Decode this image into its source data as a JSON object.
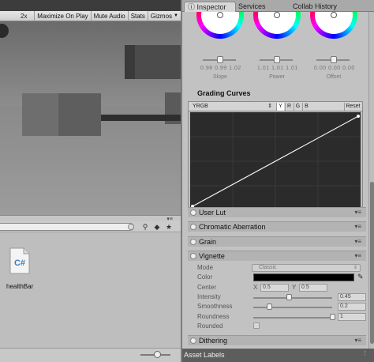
{
  "game_toolbar": {
    "zoom": "2x",
    "maximize_on_play": "Maximize On Play",
    "mute_audio": "Mute Audio",
    "stats": "Stats",
    "gizmos": "Gizmos"
  },
  "project": {
    "asset_name": "healthBar",
    "asset_glyph": "C#"
  },
  "inspector": {
    "tabs": [
      "Inspector",
      "Services",
      "Collab History"
    ],
    "wheels": [
      {
        "label": "Slope",
        "values": "0.98  0.99  1.02"
      },
      {
        "label": "Power",
        "values": "1.01  1.01  1.01"
      },
      {
        "label": "Offset",
        "values": "0.00  0.00  0.00"
      }
    ],
    "grading_curves": {
      "title": "Grading Curves",
      "mode": "YRGB",
      "channels": [
        "Y",
        "R",
        "G",
        "B"
      ],
      "active_channel": "Y",
      "reset": "Reset"
    },
    "sections": {
      "user_lut": "User Lut",
      "chromatic_aberration": "Chromatic Aberration",
      "grain": "Grain",
      "vignette": "Vignette",
      "dithering": "Dithering"
    },
    "vignette": {
      "mode_label": "Mode",
      "mode_value": "Classic",
      "color_label": "Color",
      "color": "#000000",
      "center_label": "Center",
      "center_x_label": "X",
      "center_x": "0.5",
      "center_y_label": "Y",
      "center_y": "0.5",
      "intensity_label": "Intensity",
      "intensity": "0.45",
      "smoothness_label": "Smoothness",
      "smoothness": "0.2",
      "roundness_label": "Roundness",
      "roundness": "1",
      "rounded_label": "Rounded",
      "rounded": false
    }
  },
  "asset_labels": "Asset Labels"
}
